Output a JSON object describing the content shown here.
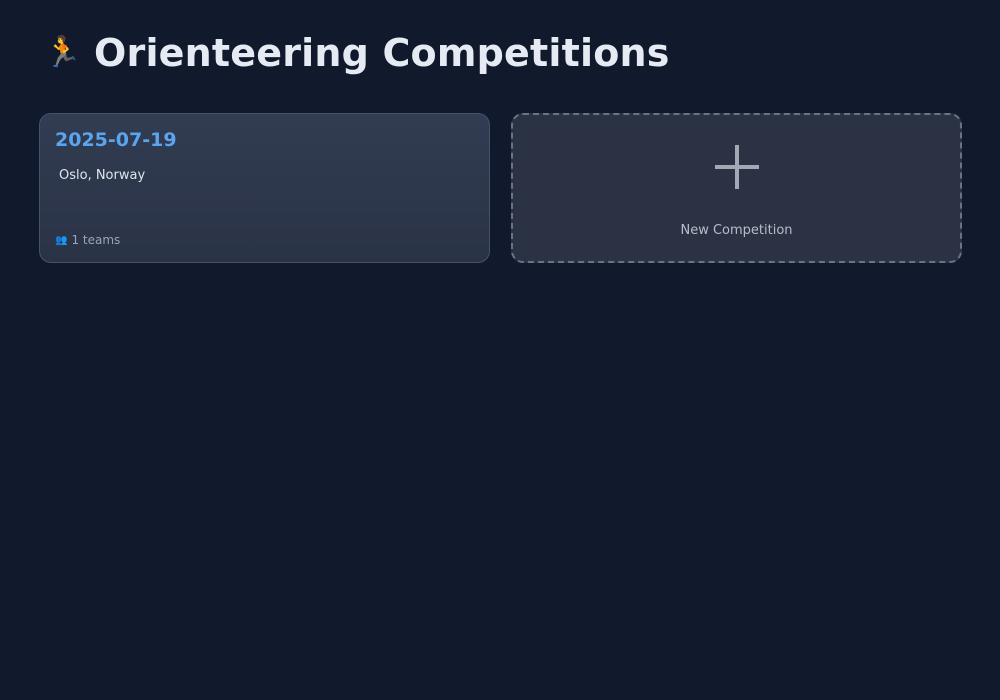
{
  "header": {
    "icon": "🏃",
    "title": "Orienteering Competitions"
  },
  "competitions": [
    {
      "date": "2025-07-19",
      "location": "Oslo, Norway",
      "teams_icon": "👥",
      "teams_label": "1 teams"
    }
  ],
  "new_competition": {
    "icon": "plus-icon",
    "label": "New Competition"
  },
  "colors": {
    "background": "#111a2c",
    "accent": "#5aa5f0",
    "card": "#2e374b",
    "dashed_border": "#6a7386"
  }
}
